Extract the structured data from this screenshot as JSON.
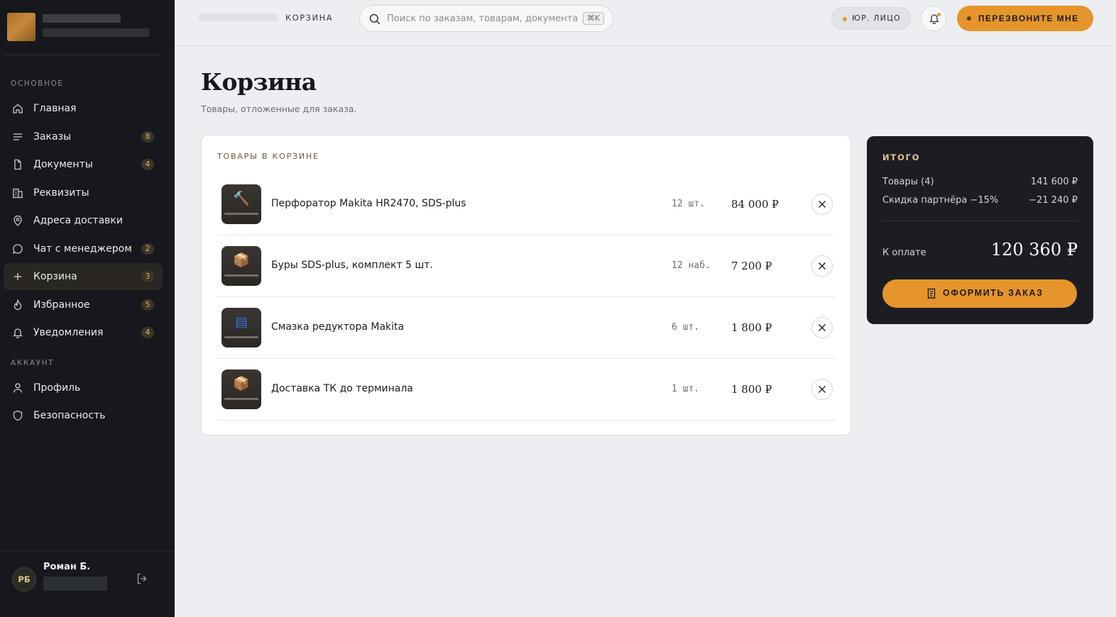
{
  "sidebar": {
    "sections": [
      {
        "label": "ОСНОВНОЕ"
      },
      {
        "label": "АККАУНТ"
      }
    ],
    "items": [
      {
        "label": "Главная",
        "icon": "home-icon",
        "badge": ""
      },
      {
        "label": "Заказы",
        "icon": "list-icon",
        "badge": "8"
      },
      {
        "label": "Документы",
        "icon": "document-icon",
        "badge": "4"
      },
      {
        "label": "Реквизиты",
        "icon": "building-icon",
        "badge": ""
      },
      {
        "label": "Адреса доставки",
        "icon": "map-pin-icon",
        "badge": ""
      },
      {
        "label": "Чат с менеджером",
        "icon": "chat-icon",
        "badge": "2"
      },
      {
        "label": "Корзина",
        "icon": "plus-icon",
        "badge": "3"
      },
      {
        "label": "Избранное",
        "icon": "flame-icon",
        "badge": "5"
      },
      {
        "label": "Уведомления",
        "icon": "bell-icon",
        "badge": "4"
      },
      {
        "label": "Профиль",
        "icon": "user-icon",
        "badge": ""
      },
      {
        "label": "Безопасность",
        "icon": "shield-icon",
        "badge": ""
      }
    ],
    "user": {
      "initials": "РБ",
      "name": "Роман Б."
    }
  },
  "topbar": {
    "breadcrumb": "КОРЗИНА",
    "search_placeholder": "Поиск по заказам, товарам, документам…",
    "search_shortcut": "⌘K",
    "entity": "ЮР. ЛИЦО",
    "callback": "ПЕРЕЗВОНИТЕ МНЕ"
  },
  "page": {
    "title": "Корзина",
    "subtitle": "Товары, отложенные для заказа."
  },
  "cart": {
    "heading": "ТОВАРЫ В КОРЗИНЕ",
    "items": [
      {
        "name": "Перфоратор Makita HR2470, SDS-plus",
        "qty": "12 шт.",
        "price": "84 000 ₽",
        "icon": "hammer-icon"
      },
      {
        "name": "Буры SDS-plus, комплект 5 шт.",
        "qty": "12 наб.",
        "price": "7 200 ₽",
        "icon": "box-icon"
      },
      {
        "name": "Смазка редуктора Makita",
        "qty": "6 шт.",
        "price": "1 800 ₽",
        "icon": "can-icon"
      },
      {
        "name": "Доставка ТК до терминала",
        "qty": "1 шт.",
        "price": "1 800 ₽",
        "icon": "box-icon"
      }
    ]
  },
  "summary": {
    "heading": "ИТОГО",
    "goods_label": "Товары (4)",
    "goods_value": "141 600 ₽",
    "discount_label": "Скидка партнёра −15%",
    "discount_value": "−21 240 ₽",
    "pay_label": "К оплате",
    "pay_total": "120 360 ₽",
    "checkout": "ОФОРМИТЬ ЗАКАЗ"
  },
  "colors": {
    "accent": "#e5952b",
    "sidebar_bg": "#16181d",
    "page_bg": "#eceef1",
    "badge_text": "#d9b37a"
  }
}
